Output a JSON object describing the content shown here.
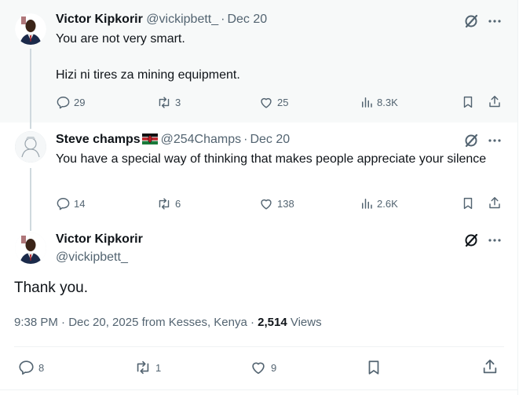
{
  "replies": [
    {
      "name": "Victor Kipkorir",
      "handle": "@vickipbett_",
      "date": "Dec 20",
      "paragraphs": [
        "You are not very smart.",
        "Hizi ni tires za mining equipment."
      ],
      "actions": {
        "replies": "29",
        "reposts": "3",
        "likes": "25",
        "views": "8.3K"
      }
    },
    {
      "name": "Steve champs",
      "handle": "@254Champs",
      "date": "Dec 20",
      "text": "You have a special way of thinking that makes people appreciate your silence",
      "actions": {
        "replies": "14",
        "reposts": "6",
        "likes": "138",
        "views": "2.6K"
      }
    }
  ],
  "main_post": {
    "name": "Victor Kipkorir",
    "handle": "@vickipbett_",
    "text": "Thank you.",
    "meta_prefix": "9:38 PM · Dec 20, 2025 from Kesses, Kenya · ",
    "views_count": "2,514",
    "views_label": " Views",
    "actions": {
      "replies": "8",
      "reposts": "1",
      "likes": "9"
    }
  },
  "colors": {
    "secondary_text": "#536471",
    "primary_text": "#0f1419",
    "thread_line": "#cfd9de"
  },
  "icons": [
    "grok-icon",
    "more-icon",
    "reply-icon",
    "repost-icon",
    "like-icon",
    "views-icon",
    "bookmark-icon",
    "share-icon",
    "kenya-flag-icon"
  ]
}
